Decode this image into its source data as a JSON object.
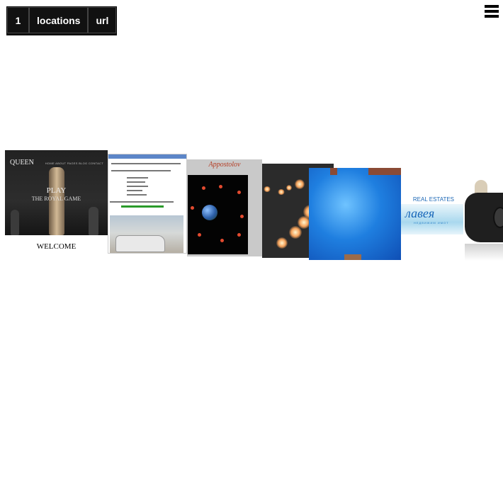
{
  "toolbar": {
    "tabs": [
      "1",
      "locations",
      "url"
    ]
  },
  "menu": {
    "icon": "hamburger-menu-icon"
  },
  "carousel": {
    "cards": [
      {
        "brand": "QUEEN",
        "nav": "HOME ABOUT PAGES BLOG CONTACT",
        "headline": "PLAY",
        "subline": "THE ROYAL GAME",
        "caption": "WELCOME"
      },
      {
        "type": "document-with-car-photo"
      },
      {
        "title": "Appostolov"
      },
      {
        "type": "fireballs"
      },
      {
        "type": "blue-abstract"
      },
      {
        "tag": "REAL ESTATES",
        "word": "лавея",
        "sub": "НЕДВИЖИМ ИМОТ"
      },
      {
        "type": "face-mask"
      }
    ]
  }
}
